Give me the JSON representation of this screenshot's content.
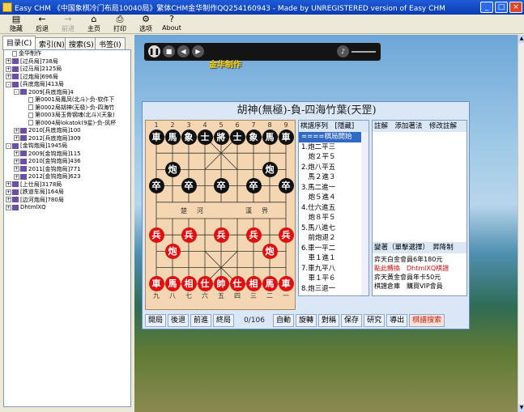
{
  "window": {
    "title": "Easy CHM 《中国象棋冷门布局10040局》繁体CHM金华制作QQ254160943 - Made by UNREGISTERED version of Easy CHM"
  },
  "toolbar": [
    {
      "icon": "hide-icon",
      "label": "隐藏",
      "enabled": true
    },
    {
      "icon": "back-arrow-icon",
      "label": "后退",
      "enabled": true
    },
    {
      "icon": "forward-arrow-icon",
      "label": "前进",
      "enabled": false
    },
    {
      "icon": "home-icon",
      "label": "主页",
      "enabled": true
    },
    {
      "icon": "print-icon",
      "label": "打印",
      "enabled": true
    },
    {
      "icon": "options-icon",
      "label": "选项",
      "enabled": true
    },
    {
      "icon": "about-icon",
      "label": "About",
      "enabled": true
    }
  ],
  "sidebar": {
    "tabs": [
      "目录(C)",
      "索引(N)",
      "搜索(S)",
      "书签(I)"
    ],
    "tree": [
      {
        "t": "金华制作",
        "lv": 0,
        "k": "page",
        "pm": ""
      },
      {
        "t": "[过兵局]738局",
        "lv": 0,
        "k": "book",
        "pm": "+"
      },
      {
        "t": "[过马局]2125局",
        "lv": 0,
        "k": "book",
        "pm": "+"
      },
      {
        "t": "[过炮局]696局",
        "lv": 0,
        "k": "book",
        "pm": "+"
      },
      {
        "t": "[兵底炮局]413局",
        "lv": 0,
        "k": "book",
        "pm": "-"
      },
      {
        "t": "2009[兵底炮局]4",
        "lv": 1,
        "k": "book",
        "pm": "-"
      },
      {
        "t": "第0001局鳳凤(北斗)-负-软件下",
        "lv": 2,
        "k": "page",
        "pm": ""
      },
      {
        "t": "第0002局胡神(无极)-负-四海竹",
        "lv": 2,
        "k": "page",
        "pm": ""
      },
      {
        "t": "第0003局玉骨钢魂(北斗)(天象)",
        "lv": 2,
        "k": "page",
        "pm": ""
      },
      {
        "t": "第0004局lokatok(9星)-负-凤杯",
        "lv": 2,
        "k": "page",
        "pm": ""
      },
      {
        "t": "2010[兵底炮局]100",
        "lv": 1,
        "k": "book",
        "pm": "+"
      },
      {
        "t": "2012[兵底炮局]309",
        "lv": 1,
        "k": "book",
        "pm": "+"
      },
      {
        "t": "[金钩炮局]1945局",
        "lv": 0,
        "k": "book",
        "pm": "-"
      },
      {
        "t": "2009[金钩炮局]115",
        "lv": 1,
        "k": "book",
        "pm": "+"
      },
      {
        "t": "2010[金钩炮局]436",
        "lv": 1,
        "k": "book",
        "pm": "+"
      },
      {
        "t": "2011[金钩炮局]771",
        "lv": 1,
        "k": "book",
        "pm": "+"
      },
      {
        "t": "2012[金钩炮局]623",
        "lv": 1,
        "k": "book",
        "pm": "+"
      },
      {
        "t": "[上仕局]3178局",
        "lv": 0,
        "k": "book",
        "pm": "+"
      },
      {
        "t": "[跌道车局]164局",
        "lv": 0,
        "k": "book",
        "pm": "+"
      },
      {
        "t": "[边河炮局]780局",
        "lv": 0,
        "k": "book",
        "pm": "+"
      },
      {
        "t": "DhtmlXQ",
        "lv": 0,
        "k": "book",
        "pm": "+"
      }
    ]
  },
  "player": {
    "brand": "金华制作"
  },
  "game": {
    "title": "胡神(無極)-負-四海竹葉(天罡)",
    "files_top": [
      "1",
      "2",
      "3",
      "4",
      "5",
      "6",
      "7",
      "8",
      "9"
    ],
    "files_bottom": [
      "九",
      "八",
      "七",
      "六",
      "五",
      "四",
      "三",
      "二",
      "一"
    ],
    "river_left": [
      "楚",
      "河"
    ],
    "river_right": [
      "漢",
      "界"
    ],
    "pieces": [
      {
        "c": 0,
        "r": 0,
        "ch": "車",
        "side": "black"
      },
      {
        "c": 1,
        "r": 0,
        "ch": "馬",
        "side": "black"
      },
      {
        "c": 2,
        "r": 0,
        "ch": "象",
        "side": "black"
      },
      {
        "c": 3,
        "r": 0,
        "ch": "士",
        "side": "black"
      },
      {
        "c": 4,
        "r": 0,
        "ch": "將",
        "side": "black"
      },
      {
        "c": 5,
        "r": 0,
        "ch": "士",
        "side": "black"
      },
      {
        "c": 6,
        "r": 0,
        "ch": "象",
        "side": "black"
      },
      {
        "c": 7,
        "r": 0,
        "ch": "馬",
        "side": "black"
      },
      {
        "c": 8,
        "r": 0,
        "ch": "車",
        "side": "black"
      },
      {
        "c": 1,
        "r": 2,
        "ch": "炮",
        "side": "black"
      },
      {
        "c": 7,
        "r": 2,
        "ch": "炮",
        "side": "black"
      },
      {
        "c": 0,
        "r": 3,
        "ch": "卒",
        "side": "black"
      },
      {
        "c": 2,
        "r": 3,
        "ch": "卒",
        "side": "black"
      },
      {
        "c": 4,
        "r": 3,
        "ch": "卒",
        "side": "black"
      },
      {
        "c": 6,
        "r": 3,
        "ch": "卒",
        "side": "black"
      },
      {
        "c": 8,
        "r": 3,
        "ch": "卒",
        "side": "black"
      },
      {
        "c": 0,
        "r": 6,
        "ch": "兵",
        "side": "red"
      },
      {
        "c": 2,
        "r": 6,
        "ch": "兵",
        "side": "red"
      },
      {
        "c": 4,
        "r": 6,
        "ch": "兵",
        "side": "red"
      },
      {
        "c": 6,
        "r": 6,
        "ch": "兵",
        "side": "red"
      },
      {
        "c": 8,
        "r": 6,
        "ch": "兵",
        "side": "red"
      },
      {
        "c": 1,
        "r": 7,
        "ch": "炮",
        "side": "red"
      },
      {
        "c": 7,
        "r": 7,
        "ch": "炮",
        "side": "red"
      },
      {
        "c": 0,
        "r": 9,
        "ch": "車",
        "side": "red"
      },
      {
        "c": 1,
        "r": 9,
        "ch": "馬",
        "side": "red"
      },
      {
        "c": 2,
        "r": 9,
        "ch": "相",
        "side": "red"
      },
      {
        "c": 3,
        "r": 9,
        "ch": "仕",
        "side": "red"
      },
      {
        "c": 4,
        "r": 9,
        "ch": "帥",
        "side": "red"
      },
      {
        "c": 5,
        "r": 9,
        "ch": "仕",
        "side": "red"
      },
      {
        "c": 6,
        "r": 9,
        "ch": "相",
        "side": "red"
      },
      {
        "c": 7,
        "r": 9,
        "ch": "馬",
        "side": "red"
      },
      {
        "c": 8,
        "r": 9,
        "ch": "車",
        "side": "red"
      }
    ],
    "moves_header": "棋譜序列　[隱藏]",
    "moves": [
      "====棋局開始",
      "1.炮二平三",
      "　炮２平５",
      "2.炮八平五",
      "　馬２進３",
      "3.馬二進一",
      "　炮５進４",
      "4.仕六進五",
      "　炮８平５",
      "5.馬八進七",
      "　前炮退２",
      "6.車一平二",
      "　車１進１",
      "7.車九平八",
      "　車１平６",
      "8.炮三退一"
    ],
    "annot_header": "註解　添加著法　修改註解",
    "ad_header": "變著（單擊選擇）　昇降制",
    "ads": [
      {
        "t": "弈天白金會員6年180元",
        "color": "#000000"
      },
      {
        "t": "點此轉換　DhtmlXQ棋譜",
        "color": "#d01010"
      },
      {
        "t": "弈天黃金會員年卡50元",
        "color": "#000000"
      },
      {
        "t": "棋譜倉庫　購買VIP會員",
        "color": "#000000"
      }
    ],
    "buttons_left": [
      "開局",
      "後退",
      "前進",
      "終局"
    ],
    "counter": "0/106",
    "buttons_right": [
      "自動",
      "旋轉",
      "對稱",
      "保存",
      "研究",
      "導出"
    ],
    "search_button": "棋譜搜索"
  }
}
